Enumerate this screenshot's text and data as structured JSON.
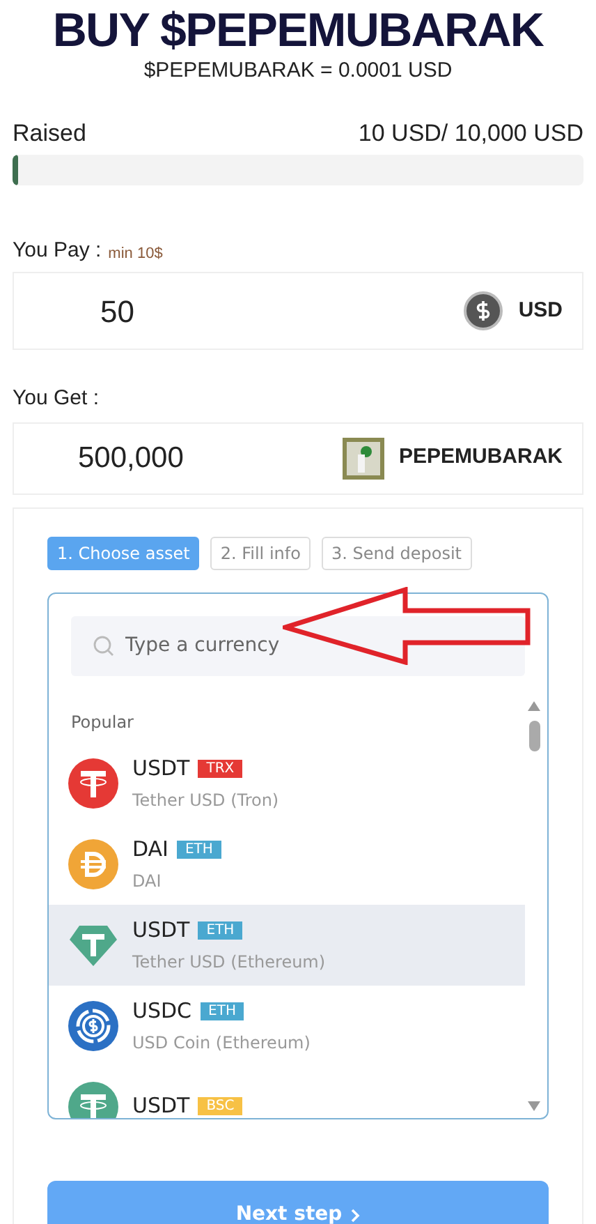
{
  "header": {
    "title": "BUY $PEPEMUBARAK",
    "rate": "$PEPEMUBARAK = 0.0001 USD"
  },
  "raised": {
    "label": "Raised",
    "amount": "10 USD/ 10,000 USD",
    "level": 0.01
  },
  "pay": {
    "label": "You Pay :",
    "hint": "min 10$",
    "value": "50",
    "currency": "USD"
  },
  "get": {
    "label": "You Get :",
    "value": "500,000",
    "currency": "PEPEMUBARAK"
  },
  "steps": [
    {
      "label": "1. Choose asset",
      "selected": true
    },
    {
      "label": "2. Fill info",
      "selected": false
    },
    {
      "label": "3. Send deposit",
      "selected": false
    }
  ],
  "search": {
    "placeholder": "Type a currency"
  },
  "section_label": "Popular",
  "assets": [
    {
      "symbol": "USDT",
      "network": "TRX",
      "color": "#e53935",
      "kind": "tether_tron",
      "name": "Tether USD (Tron)",
      "selected": false
    },
    {
      "symbol": "DAI",
      "network": "ETH",
      "color": "#4aa8d0",
      "kind": "dai",
      "name": "DAI",
      "selected": false
    },
    {
      "symbol": "USDT",
      "network": "ETH",
      "color": "#4aa8d0",
      "kind": "tether_diamond",
      "name": "Tether USD (Ethereum)",
      "selected": true
    },
    {
      "symbol": "USDC",
      "network": "ETH",
      "color": "#4aa8d0",
      "kind": "usdc",
      "name": "USD Coin (Ethereum)",
      "selected": false
    },
    {
      "symbol": "USDT",
      "network": "BSC",
      "color": "#f7c145",
      "kind": "tether",
      "selected": false
    }
  ],
  "next_button": "Next step"
}
